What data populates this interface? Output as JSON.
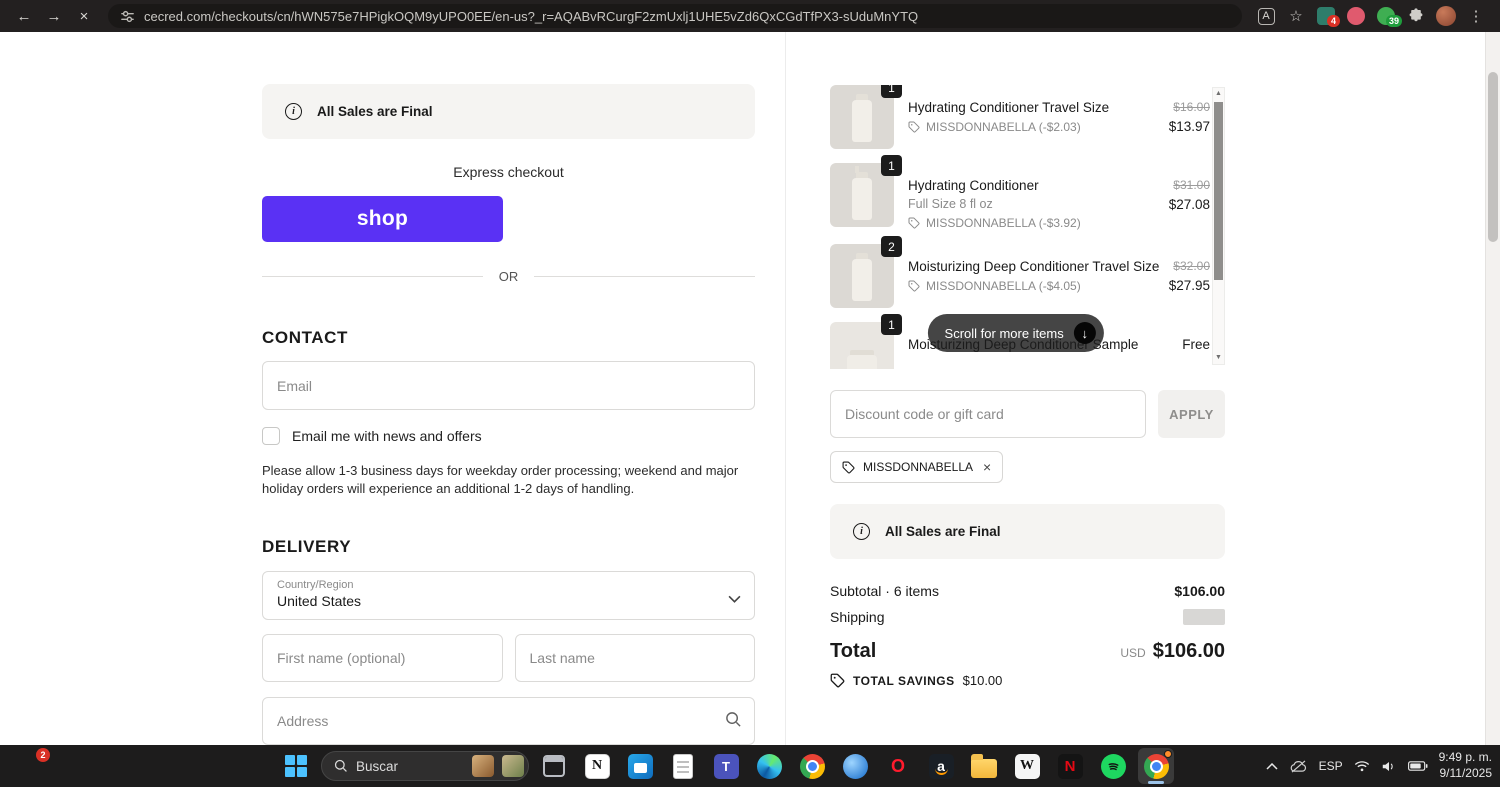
{
  "browser": {
    "url": "cecred.com/checkouts/cn/hWN575e7HPigkOQM9yUPO0EE/en-us?_r=AQABvRCurgF2zmUxlj1UHE5vZd6QxCGdTfPX3-sUduMnYTQ",
    "extension_badge_1": "4",
    "extension_badge_2": "39"
  },
  "icons": {
    "back": "←",
    "forward": "→",
    "stop": "×",
    "star": "☆",
    "menu": "⋮",
    "info": "i",
    "pill_arrow": "↓",
    "chip_close": "×",
    "scroll_up": "▲",
    "scroll_down": "▼",
    "translate": "A",
    "notion": "N",
    "teams": "T",
    "opera": "O",
    "amazon": "a",
    "wikipedia": "W",
    "netflix": "N"
  },
  "checkout": {
    "sales_banner": "All Sales are Final",
    "express_label": "Express checkout",
    "shop_pay_label": "shop",
    "or_label": "OR",
    "contact_heading": "CONTACT",
    "email_placeholder": "Email",
    "newsletter_label": "Email me with news and offers",
    "processing_note": "Please allow 1-3 business days for weekday order processing; weekend and major holiday orders will experience an additional 1-2 days of handling.",
    "delivery_heading": "DELIVERY",
    "country_label": "Country/Region",
    "country_value": "United States",
    "first_name_placeholder": "First name (optional)",
    "last_name_placeholder": "Last name",
    "address_placeholder": "Address"
  },
  "order": {
    "items": [
      {
        "qty": "1",
        "name": "Hydrating Conditioner Travel Size",
        "discount": "MISSDONNABELLA (-$2.03)",
        "old_price": "$16.00",
        "price": "$13.97"
      },
      {
        "qty": "1",
        "name": "Hydrating Conditioner",
        "variant": "Full Size 8 fl oz",
        "discount": "MISSDONNABELLA (-$3.92)",
        "old_price": "$31.00",
        "price": "$27.08"
      },
      {
        "qty": "2",
        "name": "Moisturizing Deep Conditioner Travel Size",
        "discount": "MISSDONNABELLA (-$4.05)",
        "old_price": "$32.00",
        "price": "$27.95"
      },
      {
        "qty": "1",
        "name": "Moisturizing Deep Conditioner Sample",
        "price": "Free"
      }
    ],
    "scroll_more_label": "Scroll for more items",
    "discount_placeholder": "Discount code or gift card",
    "apply_label": "APPLY",
    "applied_code": "MISSDONNABELLA",
    "sales_banner": "All Sales are Final",
    "subtotal_label": "Subtotal · 6 items",
    "subtotal_value": "$106.00",
    "shipping_label": "Shipping",
    "total_label": "Total",
    "currency": "USD",
    "total_value": "$106.00",
    "savings_label": "TOTAL SAVINGS",
    "savings_value": "$10.00"
  },
  "taskbar": {
    "widget_badge": "2",
    "search_placeholder": "Buscar",
    "language": "ESP",
    "time": "9:49 p. m.",
    "date": "9/11/2025"
  },
  "colors": {
    "shop_purple": "#5a31f4",
    "banner_bg": "#f5f4f2",
    "text_dark": "#1a1a1a",
    "taskbar_bg": "#1d1c1c"
  }
}
